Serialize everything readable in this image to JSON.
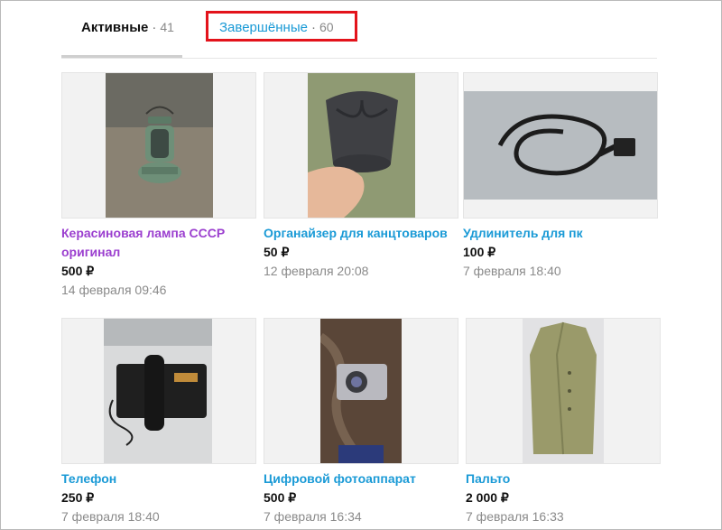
{
  "tabs": [
    {
      "label": "Активные",
      "separator": "·",
      "count": "41"
    },
    {
      "label": "Завершённые",
      "separator": "·",
      "count": "60"
    }
  ],
  "items": [
    {
      "title": "Керасиновая лампа СССР оригинал",
      "price": "500 ₽",
      "date": "14 февраля 09:46",
      "image": "kerosene-lamp-photo"
    },
    {
      "title": "Органайзер для канцтоваров",
      "price": "50 ₽",
      "date": "12 февраля 20:08",
      "image": "desk-organizer-photo"
    },
    {
      "title": "Удлинитель для пк",
      "price": "100 ₽",
      "date": "7 февраля 18:40",
      "image": "pc-power-cable-photo"
    },
    {
      "title": "Телефон",
      "price": "250 ₽",
      "date": "7 февраля 18:40",
      "image": "desk-phone-photo"
    },
    {
      "title": "Цифровой фотоаппарат",
      "price": "500 ₽",
      "date": "7 февраля 16:34",
      "image": "digital-camera-photo"
    },
    {
      "title": "Пальто",
      "price": "2 000 ₽",
      "date": "7 февраля 16:33",
      "image": "coat-photo"
    }
  ],
  "colors": {
    "link": "#1a9ad6",
    "visited": "#9b3fcf",
    "highlight": "#e3131b",
    "muted": "#8a8a8a"
  }
}
